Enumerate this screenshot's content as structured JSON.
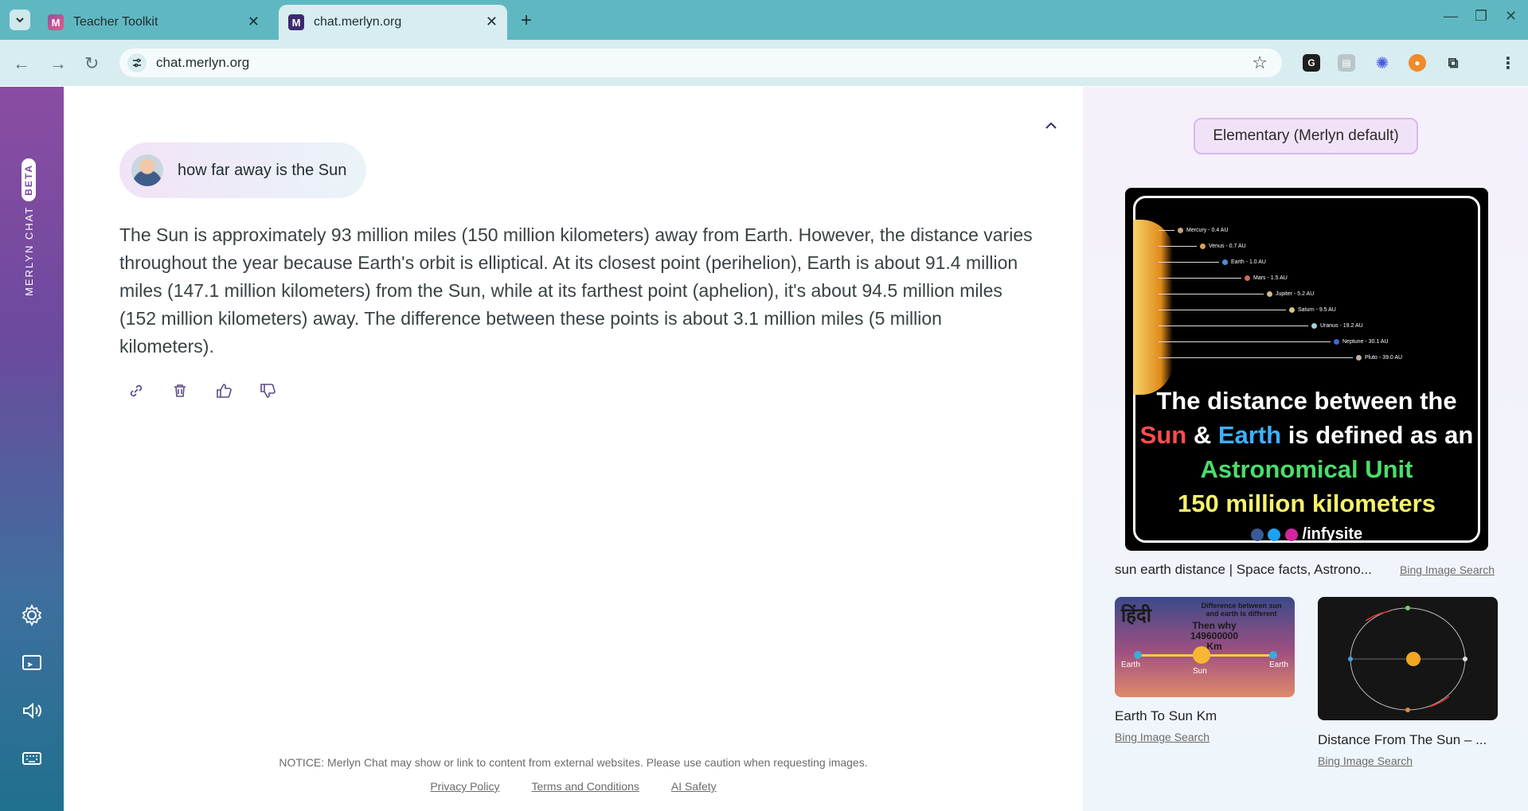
{
  "browser": {
    "tabs": [
      {
        "title": "Teacher Toolkit",
        "favicon": "M"
      },
      {
        "title": "chat.merlyn.org",
        "favicon": "M"
      }
    ],
    "url": "chat.merlyn.org"
  },
  "sidebar": {
    "brand": "MERLYN CHAT",
    "badge": "BETA",
    "icons": [
      "gear-icon",
      "cast-icon",
      "speaker-icon",
      "keyboard-icon"
    ]
  },
  "chat": {
    "prompt": "how far away is the Sun",
    "answer": "The Sun is approximately 93 million miles (150 million kilometers) away from Earth. However, the distance varies throughout the year because Earth's orbit is elliptical. At its closest point (perihelion), Earth is about 91.4 million miles (147.1 million kilometers) from the Sun, while at its farthest point (aphelion), it's about 94.5 million miles (152 million kilometers) away. The difference between these points is about 3.1 million miles (5 million kilometers)."
  },
  "footer": {
    "notice": "NOTICE: Merlyn Chat may show or link to content from external websites. Please use caution when requesting images.",
    "links": [
      "Privacy Policy",
      "Terms and Conditions",
      "AI Safety"
    ]
  },
  "panel": {
    "level": "Elementary (Merlyn default)",
    "main_image": {
      "planets": [
        {
          "label": "Mercury - 0.4 AU",
          "color": "#c9a27a"
        },
        {
          "label": "Venus - 0.7 AU",
          "color": "#e0a050"
        },
        {
          "label": "Earth - 1.0 AU",
          "color": "#4a90d9"
        },
        {
          "label": "Mars - 1.5 AU",
          "color": "#d06a4a"
        },
        {
          "label": "Jupiter - 5.2 AU",
          "color": "#d8b890"
        },
        {
          "label": "Saturn - 9.5 AU",
          "color": "#d9c27a"
        },
        {
          "label": "Uranus - 19.2 AU",
          "color": "#9ad0e0"
        },
        {
          "label": "Neptune - 30.1 AU",
          "color": "#3a6ad9"
        },
        {
          "label": "Pluto - 39.0 AU",
          "color": "#c0b0a0"
        }
      ],
      "line1": "The distance between the",
      "sun": "Sun",
      "amp": " & ",
      "earth": "Earth",
      "defined": " is defined as an",
      "line3": "Astronomical Unit",
      "line4": "150 million kilometers",
      "social": "/infysite",
      "caption": "sun earth distance | Space facts, Astrono...",
      "source": "Bing Image Search"
    },
    "thumb1": {
      "lang": "हिंदी",
      "note1": "Difference between sun",
      "note2": "and earth is different",
      "q1": "Then why",
      "q2": "149600000",
      "q3": "Km",
      "left": "Earth",
      "center": "Sun",
      "right": "Earth",
      "caption": "Earth To Sun Km",
      "source": "Bing Image Search"
    },
    "thumb2": {
      "caption": "Distance From The Sun – ...",
      "source": "Bing Image Search"
    }
  }
}
